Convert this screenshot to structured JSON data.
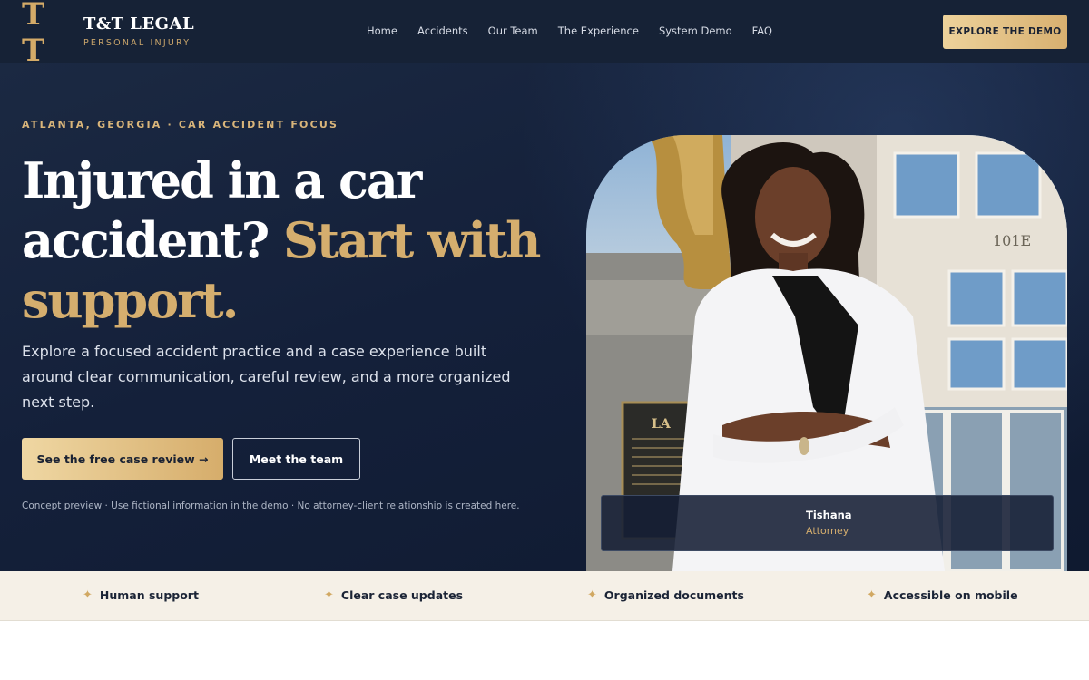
{
  "brand": {
    "mark": "T T",
    "title": "T&T LEGAL",
    "subtitle": "PERSONAL INJURY"
  },
  "nav": {
    "links": [
      "Home",
      "Accidents",
      "Our Team",
      "The Experience",
      "System Demo",
      "FAQ"
    ],
    "cta": "EXPLORE THE DEMO"
  },
  "hero": {
    "eyebrow": "ATLANTA, GEORGIA · CAR ACCIDENT FOCUS",
    "headline_line1": "Injured in a car",
    "headline_line2a": "accident?",
    "headline_line2b": "Start with",
    "headline_line3": "support.",
    "lead": "Explore a focused accident practice and a case experience built around clear communication, careful review, and a more organized next step.",
    "primary_button": "See the free case review →",
    "secondary_button": "Meet the team",
    "disclaimer": "Concept preview · Use fictional information in the demo · No attorney-client relationship is created here."
  },
  "photo": {
    "building_number": "101E",
    "plaque_text": "LA",
    "caption_name": "Tishana",
    "caption_role": "Attorney"
  },
  "features": [
    {
      "icon": "sparkle-icon",
      "label": "Human support"
    },
    {
      "icon": "sparkle-icon",
      "label": "Clear case updates"
    },
    {
      "icon": "sparkle-icon",
      "label": "Organized documents"
    },
    {
      "icon": "sparkle-icon",
      "label": "Accessible on mobile"
    }
  ],
  "colors": {
    "navy": "#162236",
    "gold": "#d5ae6e",
    "cream": "#f5f0e7"
  }
}
